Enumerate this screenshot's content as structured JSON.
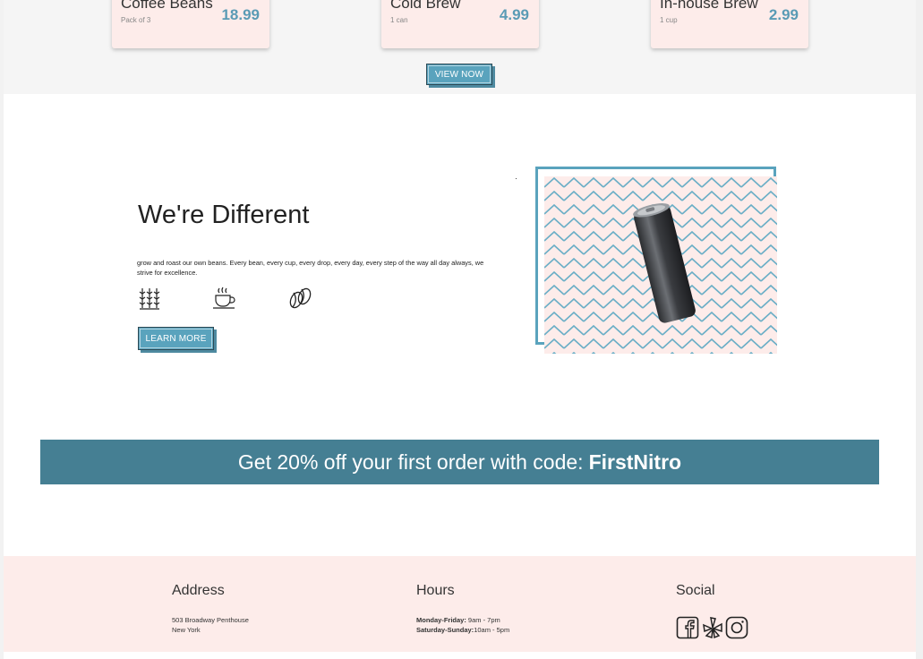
{
  "products": [
    {
      "name": "Coffee Beans",
      "sub": "Pack of 3",
      "price": "18.99"
    },
    {
      "name": "Cold Brew",
      "sub": "1 can",
      "price": "4.99"
    },
    {
      "name": "In-house Brew",
      "sub": "1 cup",
      "price": "2.99"
    }
  ],
  "view_now_label": "VIEW NOW",
  "different": {
    "title": "We're Different",
    "body": "grow and roast our own beans. Every bean, every cup, every drop, every day, every step of the way all day always, we strive for excellence.",
    "icons": [
      "coffee-plant-icon",
      "coffee-cup-icon",
      "coffee-bean-icon"
    ],
    "learn_more_label": "LEARN MORE"
  },
  "promo": {
    "text": "Get 20% off your first order with code:",
    "code": "FirstNitro"
  },
  "footer": {
    "address": {
      "heading": "Address",
      "line1": "503 Broadway Penthouse",
      "line2": "New York"
    },
    "hours": {
      "heading": "Hours",
      "weekday_label": "Monday-Friday:",
      "weekday_value": " 9am - 7pm",
      "weekend_label": "Saturday-Sunday:",
      "weekend_value": "10am - 5pm"
    },
    "social": {
      "heading": "Social",
      "icons": [
        "facebook-icon",
        "yelp-icon",
        "instagram-icon"
      ]
    }
  },
  "colors": {
    "accent": "#5aa3bd",
    "banner": "#457f93",
    "blush": "#fdecea"
  }
}
